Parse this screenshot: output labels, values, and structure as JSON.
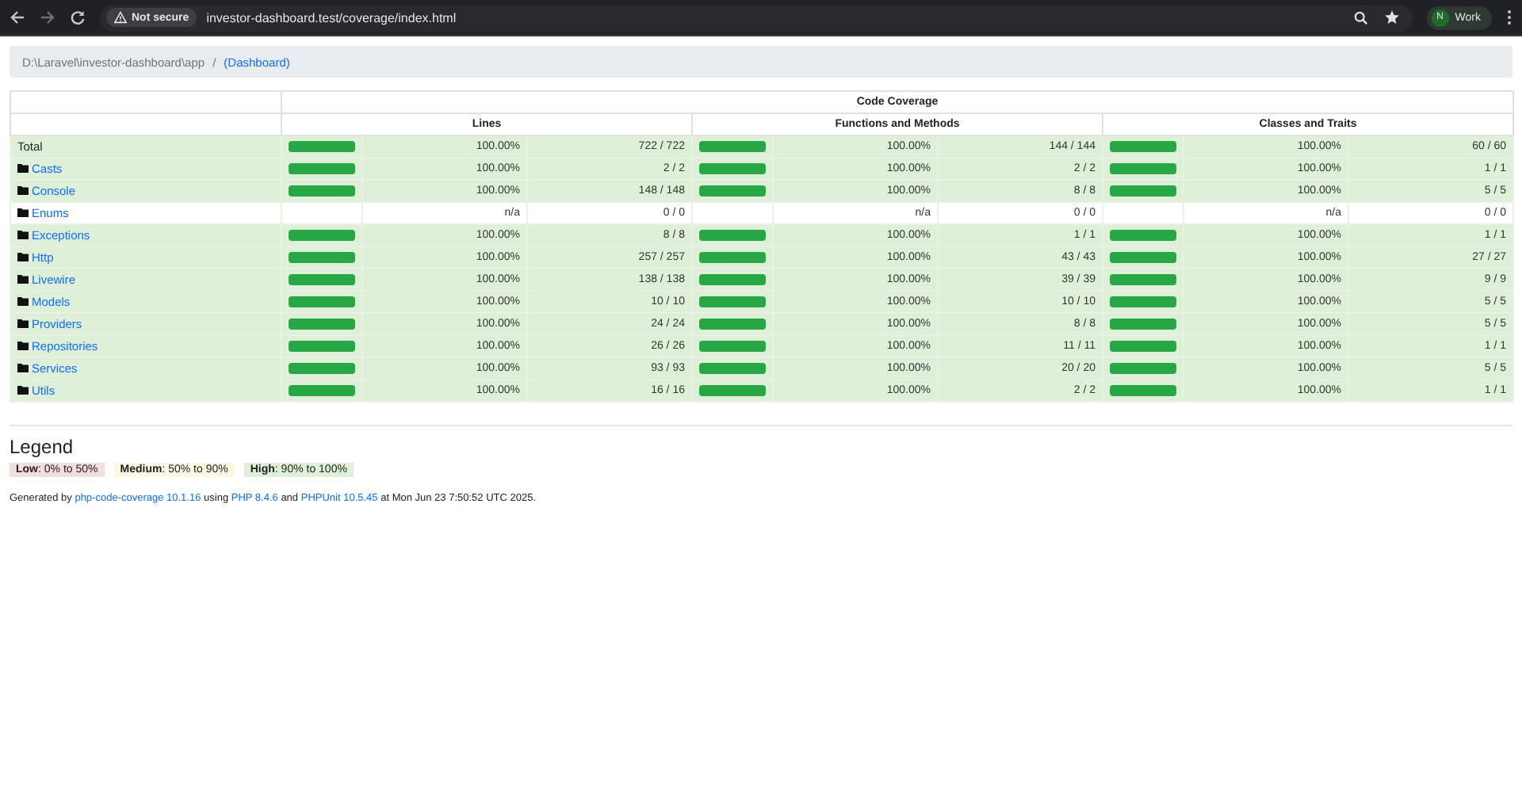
{
  "browser": {
    "security": "Not secure",
    "url": "investor-dashboard.test/coverage/index.html",
    "profile_initial": "N",
    "profile_name": "Work"
  },
  "breadcrumb": {
    "path": "D:\\Laravel\\investor-dashboard\\app",
    "separator": "/",
    "current": "(Dashboard)"
  },
  "table": {
    "title": "Code Coverage",
    "groups": [
      "Lines",
      "Functions and Methods",
      "Classes and Traits"
    ],
    "rows": [
      {
        "kind": "total",
        "name": "Total",
        "color": "#dff0d8",
        "metrics": [
          {
            "level": 1,
            "percent": "100.00%",
            "count": "722 / 722"
          },
          {
            "level": 1,
            "percent": "100.00%",
            "count": "144 / 144"
          },
          {
            "level": 1,
            "percent": "100.00%",
            "count": "60 / 60"
          }
        ]
      },
      {
        "kind": "directory",
        "name": "Casts",
        "color": "#dff0d8",
        "metrics": [
          {
            "level": 1,
            "percent": "100.00%",
            "count": "2 / 2"
          },
          {
            "level": 1,
            "percent": "100.00%",
            "count": "2 / 2"
          },
          {
            "level": 1,
            "percent": "100.00%",
            "count": "1 / 1"
          }
        ]
      },
      {
        "kind": "directory",
        "name": "Console",
        "color": "#dff0d8",
        "metrics": [
          {
            "level": 1,
            "percent": "100.00%",
            "count": "148 / 148"
          },
          {
            "level": 1,
            "percent": "100.00%",
            "count": "8 / 8"
          },
          {
            "level": 1,
            "percent": "100.00%",
            "count": "5 / 5"
          }
        ]
      },
      {
        "kind": "directory",
        "name": "Enums",
        "color": "#ffffff",
        "metrics": [
          {
            "percent": "n/a",
            "count": "0 / 0"
          },
          {
            "percent": "n/a",
            "count": "0 / 0"
          },
          {
            "percent": "n/a",
            "count": "0 / 0"
          }
        ]
      },
      {
        "kind": "directory",
        "name": "Exceptions",
        "color": "#dff0d8",
        "metrics": [
          {
            "level": 1,
            "percent": "100.00%",
            "count": "8 / 8"
          },
          {
            "level": 1,
            "percent": "100.00%",
            "count": "1 / 1"
          },
          {
            "level": 1,
            "percent": "100.00%",
            "count": "1 / 1"
          }
        ]
      },
      {
        "kind": "directory",
        "name": "Http",
        "color": "#dff0d8",
        "metrics": [
          {
            "level": 1,
            "percent": "100.00%",
            "count": "257 / 257"
          },
          {
            "level": 1,
            "percent": "100.00%",
            "count": "43 / 43"
          },
          {
            "level": 1,
            "percent": "100.00%",
            "count": "27 / 27"
          }
        ]
      },
      {
        "kind": "directory",
        "name": "Livewire",
        "color": "#dff0d8",
        "metrics": [
          {
            "level": 1,
            "percent": "100.00%",
            "count": "138 / 138"
          },
          {
            "level": 1,
            "percent": "100.00%",
            "count": "39 / 39"
          },
          {
            "level": 1,
            "percent": "100.00%",
            "count": "9 / 9"
          }
        ]
      },
      {
        "kind": "directory",
        "name": "Models",
        "color": "#dff0d8",
        "metrics": [
          {
            "level": 1,
            "percent": "100.00%",
            "count": "10 / 10"
          },
          {
            "level": 1,
            "percent": "100.00%",
            "count": "10 / 10"
          },
          {
            "level": 1,
            "percent": "100.00%",
            "count": "5 / 5"
          }
        ]
      },
      {
        "kind": "directory",
        "name": "Providers",
        "color": "#dff0d8",
        "metrics": [
          {
            "level": 1,
            "percent": "100.00%",
            "count": "24 / 24"
          },
          {
            "level": 1,
            "percent": "100.00%",
            "count": "8 / 8"
          },
          {
            "level": 1,
            "percent": "100.00%",
            "count": "5 / 5"
          }
        ]
      },
      {
        "kind": "directory",
        "name": "Repositories",
        "color": "#dff0d8",
        "metrics": [
          {
            "level": 1,
            "percent": "100.00%",
            "count": "26 / 26"
          },
          {
            "level": 1,
            "percent": "100.00%",
            "count": "11 / 11"
          },
          {
            "level": 1,
            "percent": "100.00%",
            "count": "1 / 1"
          }
        ]
      },
      {
        "kind": "directory",
        "name": "Services",
        "color": "#dff0d8",
        "metrics": [
          {
            "level": 1,
            "percent": "100.00%",
            "count": "93 / 93"
          },
          {
            "level": 1,
            "percent": "100.00%",
            "count": "20 / 20"
          },
          {
            "level": 1,
            "percent": "100.00%",
            "count": "5 / 5"
          }
        ]
      },
      {
        "kind": "directory",
        "name": "Utils",
        "color": "#dff0d8",
        "metrics": [
          {
            "level": 1,
            "percent": "100.00%",
            "count": "16 / 16"
          },
          {
            "level": 1,
            "percent": "100.00%",
            "count": "2 / 2"
          },
          {
            "level": 1,
            "percent": "100.00%",
            "count": "1 / 1"
          }
        ]
      }
    ]
  },
  "legend": {
    "title": "Legend",
    "items": [
      {
        "kind": "low",
        "text": "**Low**: 0% to 50%"
      },
      {
        "kind": "medium",
        "text": "**Medium**: 50% to 90%"
      },
      {
        "kind": "high",
        "text": "**High**: 90% to 100%"
      }
    ]
  },
  "footer": [
    {
      "kind": "text",
      "text": "Generated by "
    },
    {
      "kind": "link",
      "text": "php-code-coverage 10.1.16"
    },
    {
      "kind": "text",
      "text": " using "
    },
    {
      "kind": "link",
      "text": "PHP 8.4.6"
    },
    {
      "kind": "text",
      "text": " and "
    },
    {
      "kind": "link",
      "text": "PHPUnit 10.5.45"
    },
    {
      "kind": "text",
      "text": " at Mon Jun 23 7:50:52 UTC 2025."
    }
  ]
}
